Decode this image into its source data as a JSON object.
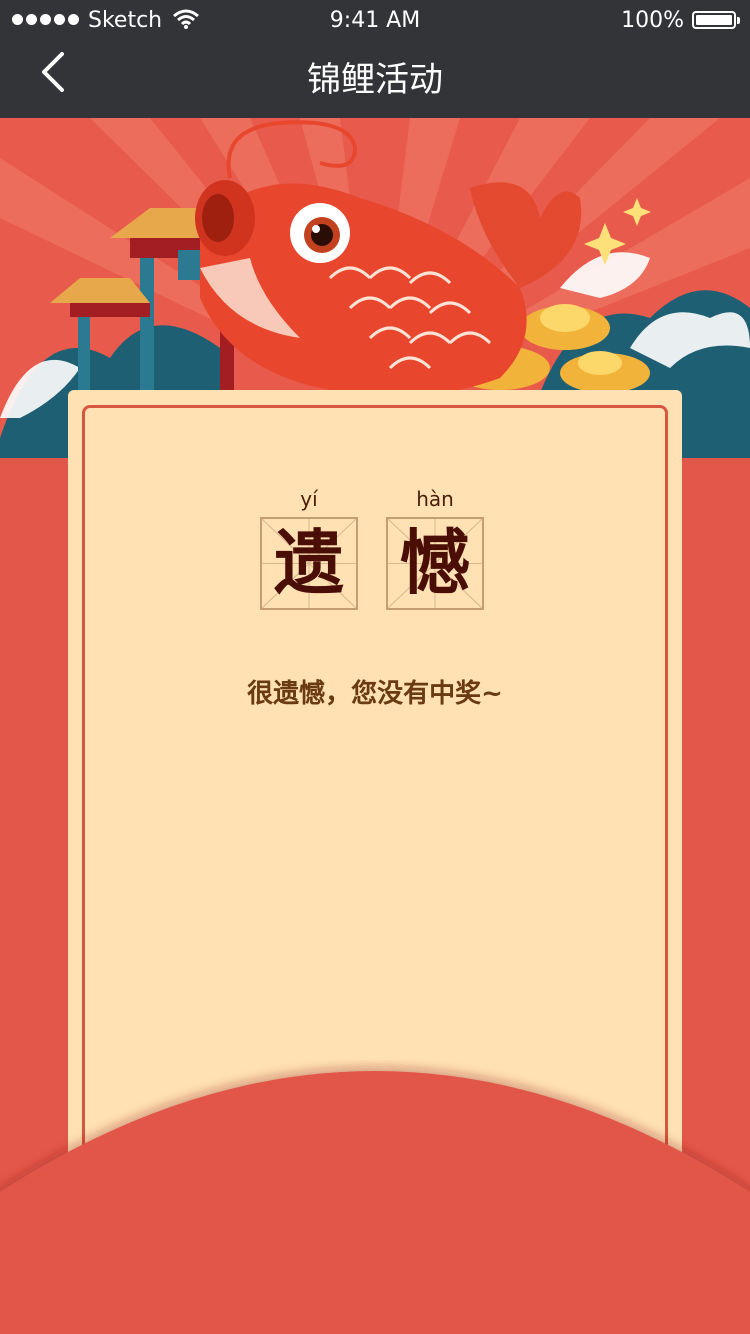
{
  "status_bar": {
    "carrier": "Sketch",
    "time": "9:41 AM",
    "battery": "100%"
  },
  "nav": {
    "title": "锦鲤活动"
  },
  "result": {
    "chars": [
      {
        "pinyin": "yí",
        "char": "遗"
      },
      {
        "pinyin": "hàn",
        "char": "憾"
      }
    ],
    "message": "很遗憾，您没有中奖~"
  },
  "colors": {
    "nav_bg": "#333438",
    "page_bg": "#E25749",
    "card_bg": "#FFE1B3",
    "card_border": "#D8563E",
    "text_dark": "#4A0E06"
  }
}
